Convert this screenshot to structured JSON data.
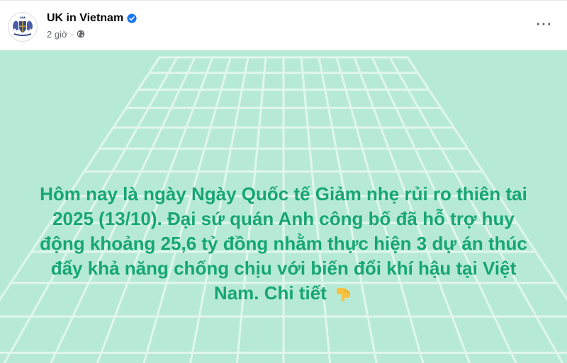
{
  "post": {
    "page_name": "UK in Vietnam",
    "timestamp": "2 giờ",
    "separator": "·",
    "more_label": "···",
    "icons": {
      "avatar": "british-royal-coat-of-arms",
      "verified": "verified-badge-icon",
      "audience": "globe-icon",
      "more": "more-options-icon",
      "emoji": "backhand-index-pointing-down"
    }
  },
  "image": {
    "background_color": "#b7ead6",
    "grid_color": "#e6f8f0",
    "text_color": "#17a673",
    "text_lines": [
      "Hôm nay là ngày Ngày Quốc tế Giảm nhẹ rủi ro thiên tai",
      "2025 (13/10). Đại sứ quán Anh công bố đã hỗ trợ huy",
      "động khoảng 25,6 tỷ đồng nhằm thực hiện 3 dự án thúc",
      "đẩy khả năng chống chịu với biến đổi khí hậu tại Việt",
      "Nam. Chi tiết"
    ],
    "trailing_emoji": "👇"
  }
}
